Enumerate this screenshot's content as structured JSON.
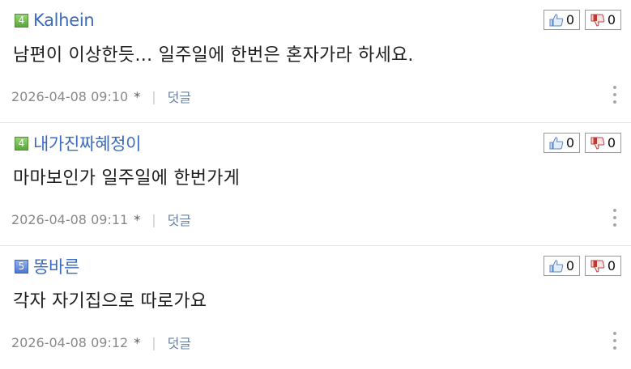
{
  "comments": [
    {
      "level": "4",
      "level_color": "#6fb84a",
      "author": "Kalhein",
      "text": "남편이 이상한듯… 일주일에 한번은 혼자가라 하세요.",
      "datetime": "2026-04-08 09:10",
      "star": "*",
      "separator": "|",
      "reply_label": "덧글",
      "likes": "0",
      "dislikes": "0"
    },
    {
      "level": "4",
      "level_color": "#6fb84a",
      "author": "내가진짜혜정이",
      "text": "마마보인가 일주일에 한번가게",
      "datetime": "2026-04-08 09:11",
      "star": "*",
      "separator": "|",
      "reply_label": "덧글",
      "likes": "0",
      "dislikes": "0"
    },
    {
      "level": "5",
      "level_color": "#5d82d6",
      "author": "똥바른",
      "text": "각자 자기집으로 따로가요",
      "datetime": "2026-04-08 09:12",
      "star": "*",
      "separator": "|",
      "reply_label": "덧글",
      "likes": "0",
      "dislikes": "0"
    }
  ]
}
